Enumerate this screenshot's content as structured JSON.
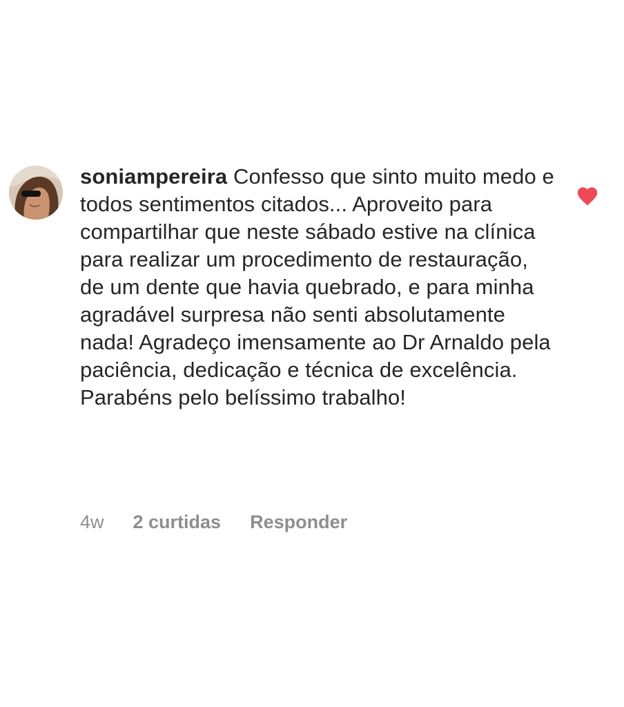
{
  "comment": {
    "username": "soniampereira",
    "text": "Confesso que sinto muito medo e todos sentimentos citados... Aproveito para compartilhar que neste sábado estive na clínica para realizar um procedimento de restauração, de um dente que havia quebrado, e para minha agradável surpresa não senti absolutamente nada! Agradeço imensamente ao Dr Arnaldo pela paciência, dedicação e técnica de excelência. Parabéns pelo belíssimo trabalho!",
    "time": "4w",
    "likes_label": "2 curtidas",
    "reply_label": "Responder",
    "liked": true,
    "like_icon": "heart-filled-icon",
    "avatar_icon": "user-avatar"
  },
  "colors": {
    "text": "#262626",
    "meta": "#8e8e8e",
    "heart": "#ed4956",
    "background": "#ffffff"
  }
}
